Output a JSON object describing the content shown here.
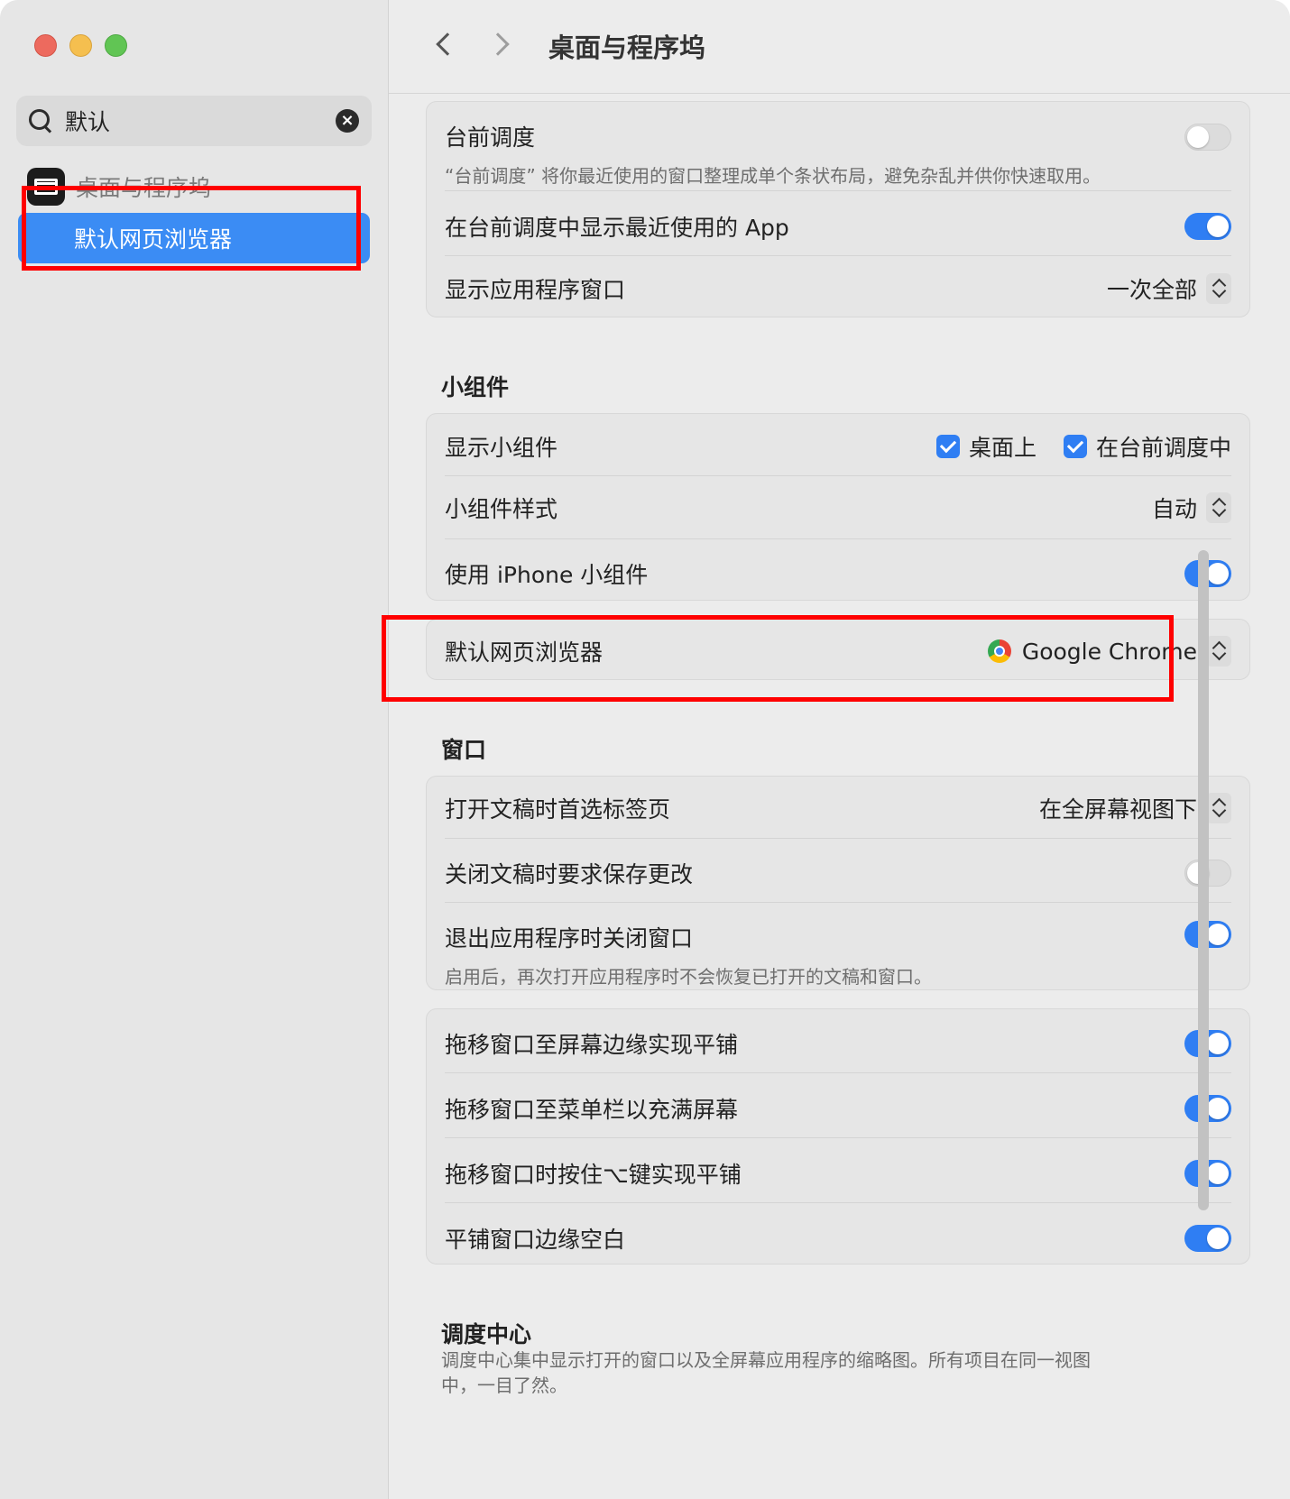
{
  "sidebar": {
    "search_value": "默认",
    "group_label": "桌面与程序坞",
    "selected_item": "默认网页浏览器"
  },
  "toolbar": {
    "title": "桌面与程序坞"
  },
  "stage_manager": {
    "label": "台前调度",
    "description": "“台前调度” 将你最近使用的窗口整理成单个条状布局，避免杂乱并供你快速取用。",
    "enabled": false,
    "show_recent_label": "在台前调度中显示最近使用的 App",
    "show_recent_enabled": true,
    "show_windows_label": "显示应用程序窗口",
    "show_windows_value": "一次全部"
  },
  "widgets": {
    "section_title": "小组件",
    "show_label": "显示小组件",
    "on_desktop_label": "桌面上",
    "on_desktop_checked": true,
    "in_stage_manager_label": "在台前调度中",
    "in_stage_manager_checked": true,
    "style_label": "小组件样式",
    "style_value": "自动",
    "iphone_label": "使用 iPhone 小组件",
    "iphone_enabled": true
  },
  "browser": {
    "label": "默认网页浏览器",
    "value": "Google Chrome"
  },
  "windows": {
    "section_title": "窗口",
    "prefer_tabs_label": "打开文稿时首选标签页",
    "prefer_tabs_value": "在全屏幕视图下",
    "ask_save_label": "关闭文稿时要求保存更改",
    "ask_save_enabled": false,
    "close_windows_label": "退出应用程序时关闭窗口",
    "close_windows_desc": "启用后，再次打开应用程序时不会恢复已打开的文稿和窗口。",
    "close_windows_enabled": true
  },
  "tiling": {
    "edge_label": "拖移窗口至屏幕边缘实现平铺",
    "edge_enabled": true,
    "menubar_label": "拖移窗口至菜单栏以充满屏幕",
    "menubar_enabled": true,
    "option_label": "拖移窗口时按住⌥键实现平铺",
    "option_enabled": true,
    "margins_label": "平铺窗口边缘空白",
    "margins_enabled": true
  },
  "mission_control": {
    "section_title": "调度中心",
    "description": "调度中心集中显示打开的窗口以及全屏幕应用程序的缩略图。所有项目在同一视图中，一目了然。"
  },
  "colors": {
    "accent": "#2f7ef3",
    "highlight": "#ff0000",
    "sidebar_selected": "#3b8cf4"
  }
}
